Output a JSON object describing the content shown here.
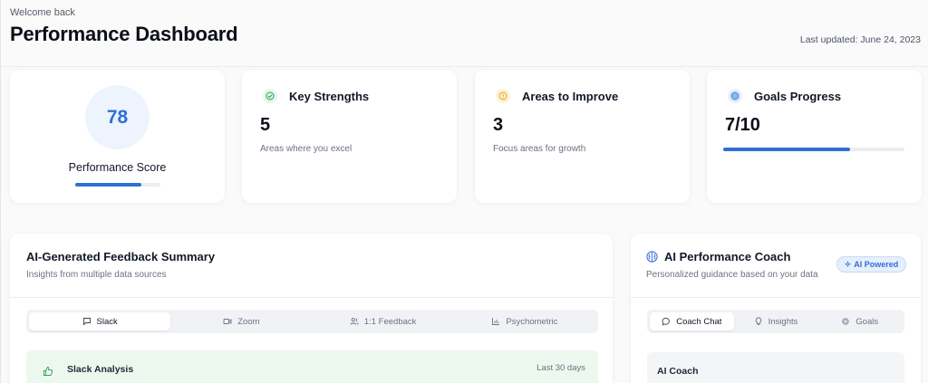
{
  "header": {
    "welcome": "Welcome back",
    "title": "Performance Dashboard",
    "last_updated": "Last updated: June 24, 2023"
  },
  "score_card": {
    "score": "78",
    "label": "Performance Score",
    "progress": 0.78
  },
  "metrics": [
    {
      "title": "Key Strengths",
      "value": "5",
      "subtitle": "Areas where you excel",
      "icon": "check-circle-icon",
      "color": "#22a455"
    },
    {
      "title": "Areas to Improve",
      "value": "3",
      "subtitle": "Focus areas for growth",
      "icon": "alert-circle-icon",
      "color": "#e3a414"
    },
    {
      "title": "Goals Progress",
      "value": "7/10",
      "subtitle": "",
      "icon": "target-icon",
      "color": "#2f6fd6",
      "progress": 0.7
    }
  ],
  "feedback": {
    "title": "AI-Generated Feedback Summary",
    "subtitle": "Insights from multiple data sources",
    "tabs": [
      {
        "label": "Slack",
        "icon": "message-square-icon",
        "active": true
      },
      {
        "label": "Zoom",
        "icon": "video-icon",
        "active": false
      },
      {
        "label": "1:1 Feedback",
        "icon": "users-icon",
        "active": false
      },
      {
        "label": "Psychometric",
        "icon": "bar-chart-icon",
        "active": false
      }
    ],
    "analysis": {
      "title": "Slack Analysis",
      "period": "Last 30 days",
      "icon": "thumbs-up-icon"
    }
  },
  "coach": {
    "title": "AI Performance Coach",
    "subtitle": "Personalized guidance based on your data",
    "badge": "AI Powered",
    "tabs": [
      {
        "label": "Coach Chat",
        "icon": "message-circle-icon",
        "active": true
      },
      {
        "label": "Insights",
        "icon": "lightbulb-icon",
        "active": false
      },
      {
        "label": "Goals",
        "icon": "target-icon",
        "active": false
      }
    ],
    "chat_title": "AI Coach"
  },
  "colors": {
    "accent": "#2f6fd6",
    "success": "#22a455",
    "warning": "#e3a414"
  }
}
